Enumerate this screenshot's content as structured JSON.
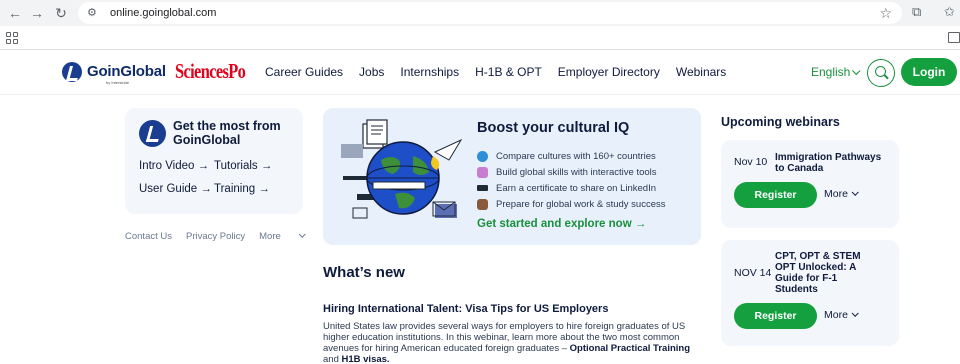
{
  "browser": {
    "url": "online.goinglobal.com"
  },
  "header": {
    "logo_text": "GoinGlobal",
    "logo_sub": "by Interstride",
    "partner_logo": "SciencesPo",
    "nav": [
      "Career Guides",
      "Jobs",
      "Internships",
      "H-1B & OPT",
      "Employer Directory",
      "Webinars"
    ],
    "language": "English",
    "login_label": "Login"
  },
  "left_card": {
    "title": "Get the most from GoinGlobal",
    "links": [
      "Intro Video →",
      "Tutorials →",
      "User Guide →",
      "Training →"
    ]
  },
  "footer_links": [
    "Contact Us",
    "Privacy Policy",
    "More"
  ],
  "promo": {
    "title": "Boost your cultural IQ",
    "items": [
      {
        "icon": "globe-icon",
        "text": "Compare cultures with 160+ countries"
      },
      {
        "icon": "chart-icon",
        "text": "Build global skills with interactive tools"
      },
      {
        "icon": "graduation-cap-icon",
        "text": "Earn a certificate to share on LinkedIn"
      },
      {
        "icon": "briefcase-icon",
        "text": "Prepare for global work & study success"
      }
    ],
    "cta": "Get started and explore now →"
  },
  "whats_new": {
    "title": "What’s new",
    "article_title": "Hiring International Talent: Visa Tips for US Employers",
    "article_body_start": "United States law provides several ways for employers to hire foreign graduates of US higher education institutions. In this webinar, learn more about the two most common avenues for hiring American educated foreign graduates – ",
    "article_bold_1": "Optional Practical Training",
    "article_and": " and ",
    "article_bold_2": "H1B visas."
  },
  "webinars": {
    "title": "Upcoming webinars",
    "items": [
      {
        "date": "Nov 10",
        "title": "Immigration Pathways to Canada",
        "register": "Register",
        "more": "More"
      },
      {
        "date": "NOV 14",
        "title": "CPT, OPT & STEM OPT Unlocked: A Guide for F-1 Students",
        "register": "Register",
        "more": "More"
      }
    ]
  },
  "colors": {
    "brand_green": "#14a03f",
    "brand_navy": "#0f1b3d",
    "card_bg": "#f3f6fa",
    "promo_bg": "#e7f0fb",
    "partner_red": "#e2001a"
  }
}
